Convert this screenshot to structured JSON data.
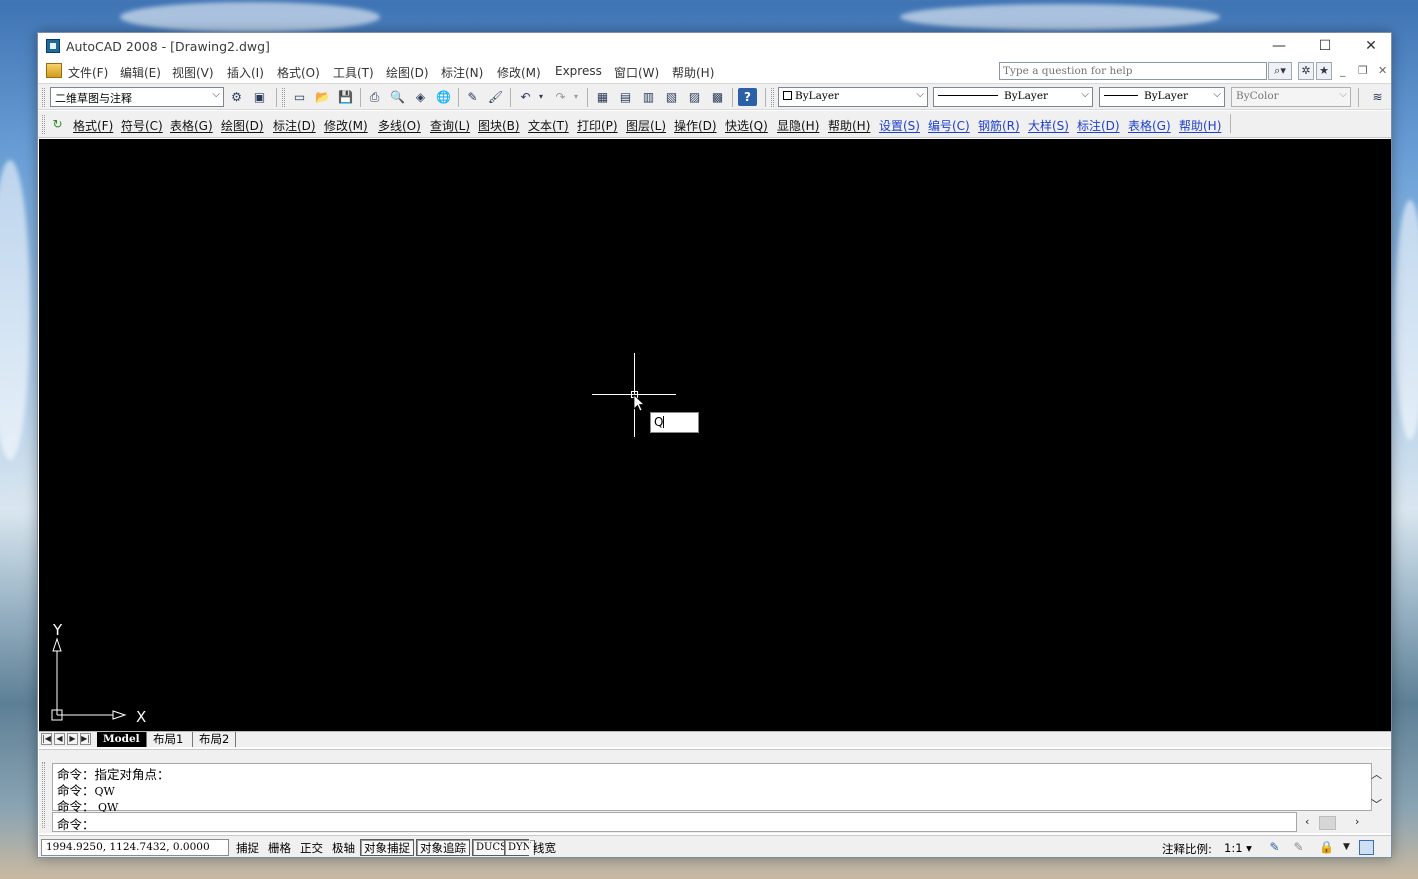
{
  "window": {
    "title": "AutoCAD 2008 - [Drawing2.dwg]",
    "controls": {
      "minimize": "—",
      "maximize": "☐",
      "close": "✕"
    }
  },
  "menubar": {
    "items": [
      "文件(F)",
      "编辑(E)",
      "视图(V)",
      "插入(I)",
      "格式(O)",
      "工具(T)",
      "绘图(D)",
      "标注(N)",
      "修改(M)",
      "Express",
      "窗口(W)",
      "帮助(H)"
    ],
    "help_placeholder": "Type a question for help",
    "mdi": {
      "minimize": "_",
      "restore": "❐",
      "close": "✕"
    }
  },
  "toolbar1": {
    "workspace": "二维草图与注释",
    "layer_color": "ByLayer",
    "linetype": "ByLayer",
    "lineweight": "ByLayer",
    "plotstyle": "ByColor"
  },
  "toolbar2": {
    "black_items": [
      "格式(F)",
      "符号(C)",
      "表格(G)",
      "绘图(D)",
      "标注(D)",
      "修改(M)",
      "多线(O)",
      "查询(L)",
      "图块(B)",
      "文本(T)",
      "打印(P)",
      "图层(L)",
      "操作(D)",
      "快选(Q)",
      "显隐(H)",
      "帮助(H)"
    ],
    "blue_items": [
      "设置(S)",
      "编号(C)",
      "钢筋(R)",
      "大样(S)",
      "标注(D)",
      "表格(G)",
      "帮助(H)"
    ]
  },
  "canvas": {
    "dynamic_input": "Q",
    "ucs": {
      "x_label": "X",
      "y_label": "Y"
    }
  },
  "tabs": {
    "nav": [
      "|◀",
      "◀",
      "▶",
      "▶|"
    ],
    "items": [
      "Model",
      "布局1",
      "布局2"
    ],
    "active": "Model"
  },
  "command": {
    "history": [
      {
        "prompt": "命令：",
        "text": "指定对角点：",
        "mono": false
      },
      {
        "prompt": "命令：",
        "text": "QW",
        "mono": true
      },
      {
        "prompt": "命令：",
        "text": " QW",
        "mono": true
      }
    ],
    "current_prompt": "命令："
  },
  "statusbar": {
    "coords": "1994.9250, 1124.7432, 0.0000",
    "toggles": [
      {
        "label": "捕捉",
        "on": false
      },
      {
        "label": "栅格",
        "on": false
      },
      {
        "label": "正交",
        "on": false
      },
      {
        "label": "极轴",
        "on": false
      },
      {
        "label": "对象捕捉",
        "on": true
      },
      {
        "label": "对象追踪",
        "on": true
      },
      {
        "label": "DUCS",
        "on": true
      },
      {
        "label": "DYN",
        "on": true
      },
      {
        "label": "线宽",
        "on": false
      }
    ],
    "annotation_scale_label": "注释比例:",
    "annotation_scale_value": "1:1"
  },
  "colors": {
    "canvas_bg": "#000000",
    "blue_menu": "#1e3fd0",
    "chrome_bg": "#f0f0f0"
  }
}
